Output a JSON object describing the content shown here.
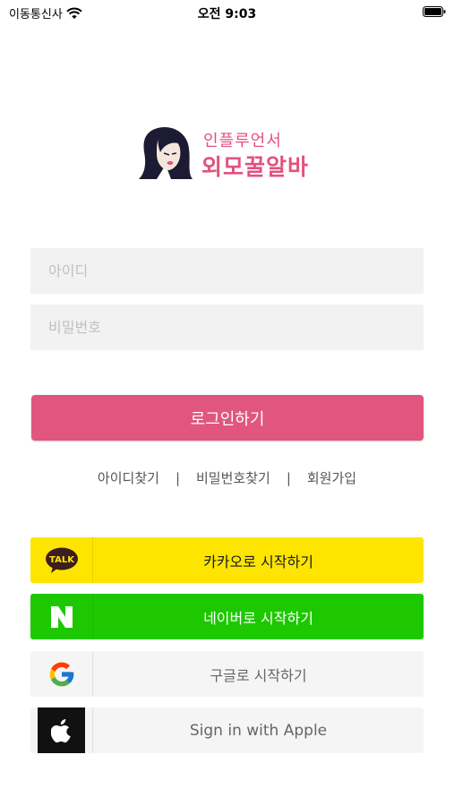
{
  "status_bar": {
    "carrier": "이동통신사",
    "time": "오전 9:03"
  },
  "logo": {
    "line1": "인플루언서",
    "line2": "외모꿀알바"
  },
  "form": {
    "id_placeholder": "아이디",
    "pw_placeholder": "비밀번호",
    "login_label": "로그인하기"
  },
  "links": {
    "find_id": "아이디찾기",
    "find_pw": "비밀번호찾기",
    "signup": "회원가입",
    "separator": "|"
  },
  "social": {
    "kakao": {
      "label": "카카오로 시작하기",
      "icon": "kakao-talk-icon",
      "badge": "TALK",
      "color": "#fee500"
    },
    "naver": {
      "label": "네이버로 시작하기",
      "icon": "naver-n-icon",
      "badge": "N",
      "color": "#1ec800"
    },
    "google": {
      "label": "구글로 시작하기",
      "icon": "google-g-icon",
      "color": "#f5f5f5"
    },
    "apple": {
      "label": "Sign in with Apple",
      "icon": "apple-icon",
      "color": "#111111"
    }
  },
  "colors": {
    "accent": "#e0567f",
    "field_bg": "#f2f2f2"
  }
}
